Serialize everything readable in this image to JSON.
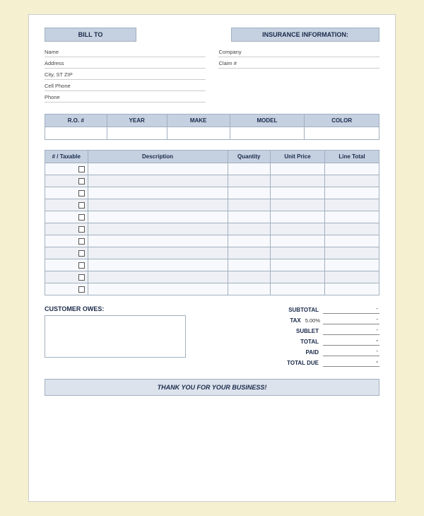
{
  "header": {
    "bill_to_label": "BILL TO",
    "insurance_label": "INSURANCE INFORMATION:"
  },
  "bill_to": {
    "name_label": "Name",
    "address_label": "Address",
    "city_label": "City, ST ZIP",
    "cell_label": "Cell Phone",
    "phone_label": "Phone"
  },
  "insurance": {
    "company_label": "Company",
    "claim_label": "Claim #"
  },
  "vehicle_table": {
    "headers": [
      "R.O. #",
      "YEAR",
      "MAKE",
      "MODEL",
      "COLOR"
    ]
  },
  "items_table": {
    "headers": [
      "# / Taxable",
      "Description",
      "Quantity",
      "Unit Price",
      "Line Total"
    ],
    "rows": 11
  },
  "totals": {
    "subtotal_label": "SUBTOTAL",
    "tax_label": "TAX",
    "tax_pct": "5.00%",
    "sublet_label": "SUBLET",
    "total_label": "TOTAL",
    "paid_label": "PAID",
    "total_due_label": "TOTAL DUE",
    "subtotal_value": "-",
    "tax_value": "-",
    "sublet_value": "-",
    "total_value": "-",
    "paid_value": "-",
    "total_due_value": "-"
  },
  "customer_owes": {
    "label": "CUSTOMER OWES:"
  },
  "footer": {
    "text": "THANK YOU FOR YOUR BUSINESS!"
  }
}
